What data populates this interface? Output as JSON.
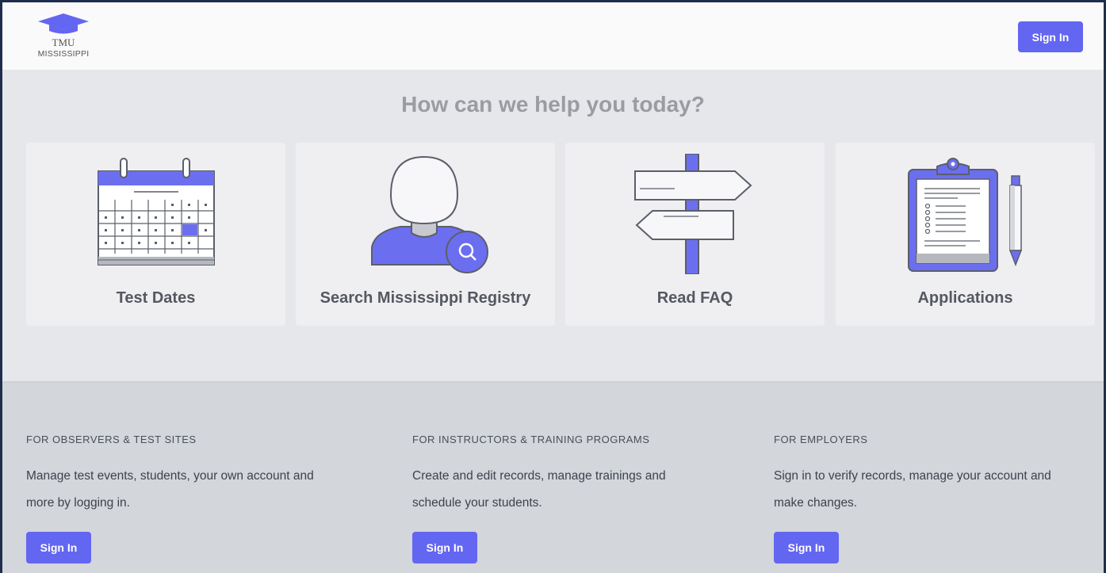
{
  "brand": {
    "name": "TMU",
    "state": "MISSISSIPPI",
    "logo_icon": "graduation-cap-icon",
    "accent_color": "#6366f1"
  },
  "header": {
    "signin_label": "Sign In"
  },
  "hero": {
    "title": "How can we help you today?",
    "cards": [
      {
        "label": "Test Dates",
        "icon": "calendar-icon"
      },
      {
        "label": "Search Mississippi Registry",
        "icon": "person-search-icon"
      },
      {
        "label": "Read FAQ",
        "icon": "signpost-icon"
      },
      {
        "label": "Applications",
        "icon": "clipboard-icon"
      }
    ]
  },
  "footer": {
    "columns": [
      {
        "heading": "FOR OBSERVERS & TEST SITES",
        "line1": "Manage test events, students, your own account and",
        "line2": "more by logging in.",
        "button": "Sign In"
      },
      {
        "heading": "FOR INSTRUCTORS & TRAINING PROGRAMS",
        "line1": "Create and edit records, manage trainings and",
        "line2": "schedule your students.",
        "button": "Sign In"
      },
      {
        "heading": "FOR EMPLOYERS",
        "line1": "Sign in to verify records, manage your account and",
        "line2": "make changes.",
        "button": "Sign In"
      }
    ]
  }
}
